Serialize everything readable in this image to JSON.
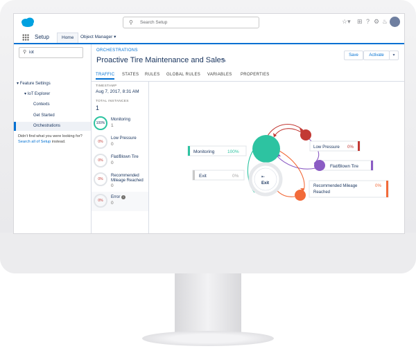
{
  "header": {
    "search_placeholder": "Search Setup"
  },
  "nav": {
    "app_name": "Setup",
    "tabs": [
      {
        "label": "Home"
      },
      {
        "label": "Object Manager"
      }
    ]
  },
  "sidebar": {
    "quick_find_value": "iot",
    "items": [
      {
        "label": "Feature Settings"
      },
      {
        "label": "IoT Explorer"
      },
      {
        "label": "Contexts"
      },
      {
        "label": "Get Started"
      },
      {
        "label": "Orchestrations"
      }
    ],
    "note_text": "Didn't find what you were looking for?",
    "note_link": "Search all of Setup",
    "note_suffix": "instead."
  },
  "page": {
    "breadcrumb": "ORCHESTRATIONS",
    "title": "Proactive Tire Maintenance and Sales",
    "save_label": "Save",
    "activate_label": "Activate",
    "tabs": [
      {
        "label": "TRAFFIC"
      },
      {
        "label": "STATES"
      },
      {
        "label": "RULES"
      },
      {
        "label": "GLOBAL RULES"
      },
      {
        "label": "VARIABLES"
      },
      {
        "label": "PROPERTIES"
      }
    ]
  },
  "stats": {
    "timestamp_label": "TIMESTAMP",
    "timestamp_value": "Aug 7, 2017, 8:31 AM",
    "total_label": "TOTAL INSTANCES",
    "total_value": "1",
    "states": [
      {
        "name": "Monitoring",
        "pct": "100%",
        "count": "1"
      },
      {
        "name": "Low Pressure",
        "pct": "0%",
        "count": "0"
      },
      {
        "name": "Flat/Blown Tire",
        "pct": "0%",
        "count": "0"
      },
      {
        "name": "Recommended Mileage Reached",
        "pct": "0%",
        "count": "0"
      },
      {
        "name": "Error",
        "pct": "0%",
        "count": "0"
      }
    ]
  },
  "diagram": {
    "monitoring": {
      "label": "Monitoring",
      "pct": "100%",
      "color": "#2dc3a1"
    },
    "exit": {
      "label": "Exit",
      "pct": "0%"
    },
    "exit_center": "Exit",
    "low_pressure": {
      "label": "Low Pressure",
      "pct": "0%",
      "color": "#c23934"
    },
    "flat_tire": {
      "label": "Flat/Blown Tire",
      "pct": "0%",
      "color": "#8b5cc4"
    },
    "mileage": {
      "label": "Recommended Mileage Reached",
      "pct": "0%",
      "color": "#f26b3a"
    }
  },
  "colors": {
    "accent": "#0070d2",
    "monitoring": "#2dc3a1",
    "low_pressure": "#c23934",
    "flat_tire": "#8b5cc4",
    "mileage": "#f26b3a"
  }
}
